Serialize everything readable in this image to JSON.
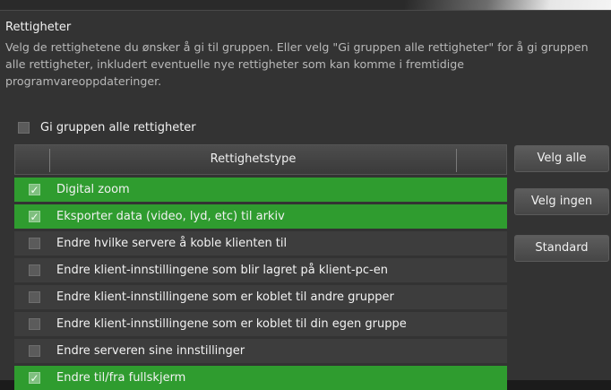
{
  "section": {
    "title": "Rettigheter",
    "description": "Velg de rettighetene du ønsker å gi til gruppen. Eller velg \"Gi gruppen alle rettigheter\" for å gi gruppen alle rettigheter, inkludert eventuelle nye rettigheter som kan komme i fremtidige programvareoppdateringer."
  },
  "all_rights": {
    "label": "Gi gruppen alle rettigheter",
    "checked": false
  },
  "table": {
    "header": "Rettighetstype",
    "rows": [
      {
        "label": "Digital zoom",
        "checked": true
      },
      {
        "label": "Eksporter data (video, lyd, etc) til arkiv",
        "checked": true
      },
      {
        "label": "Endre hvilke servere å koble klienten til",
        "checked": false
      },
      {
        "label": "Endre klient-innstillingene som blir lagret på klient-pc-en",
        "checked": false
      },
      {
        "label": "Endre klient-innstillingene som er koblet til andre grupper",
        "checked": false
      },
      {
        "label": "Endre klient-innstillingene som er koblet til din egen gruppe",
        "checked": false
      },
      {
        "label": "Endre serveren sine innstillinger",
        "checked": false
      },
      {
        "label": "Endre til/fra fullskjerm",
        "checked": true
      }
    ]
  },
  "buttons": {
    "select_all": "Velg alle",
    "select_none": "Velg ingen",
    "default": "Standard"
  },
  "colors": {
    "checked_row": "#2f9c2f",
    "unchecked_row": "#3d3d3d",
    "panel": "#333333"
  },
  "icons": {
    "check": "checkmark-icon"
  }
}
